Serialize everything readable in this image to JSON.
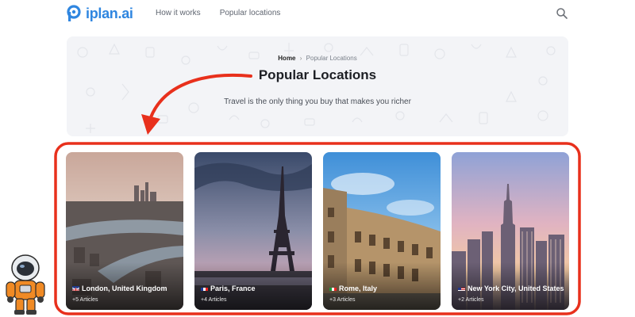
{
  "brand": {
    "name": "iplan.ai",
    "color": "#2f86e0"
  },
  "nav": {
    "items": [
      {
        "label": "How it works"
      },
      {
        "label": "Popular locations"
      }
    ],
    "search_icon": "search-icon"
  },
  "hero": {
    "breadcrumb_home": "Home",
    "breadcrumb_separator": "›",
    "breadcrumb_current": "Popular Locations",
    "title": "Popular Locations",
    "subtitle": "Travel is the only thing you buy that makes you richer"
  },
  "annotation": {
    "color": "#e8301c"
  },
  "locations": [
    {
      "name": "London, United Kingdom",
      "articles": "+5 Articles",
      "flag": "uk-flag"
    },
    {
      "name": "Paris, France",
      "articles": "+4 Articles",
      "flag": "france-flag"
    },
    {
      "name": "Rome, Italy",
      "articles": "+3 Articles",
      "flag": "italy-flag"
    },
    {
      "name": "New York City, United States",
      "articles": "+2 Articles",
      "flag": "usa-flag"
    }
  ]
}
